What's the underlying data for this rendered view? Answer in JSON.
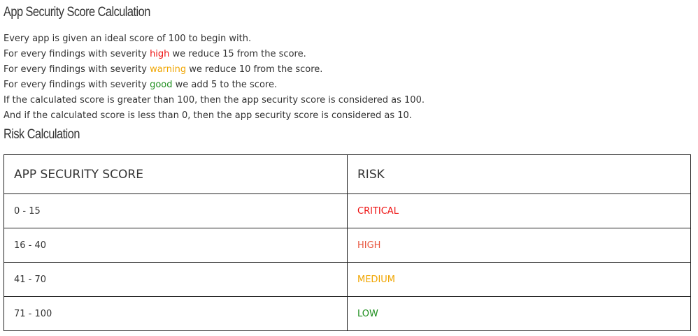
{
  "section1": {
    "title": "App Security Score Calculation",
    "intro": "Every app is given an ideal score of 100 to begin with.",
    "rules": [
      {
        "prefix": "For every findings with severity ",
        "severity": "high",
        "suffix": " we reduce 15 from the score."
      },
      {
        "prefix": "For every findings with severity ",
        "severity": "warning",
        "suffix": " we reduce 10 from the score."
      },
      {
        "prefix": "For every findings with severity ",
        "severity": "good",
        "suffix": " we add 5 to the score."
      }
    ],
    "note_max": "If the calculated score is greater than 100, then the app security score is considered as 100.",
    "note_min": "And if the calculated score is less than 0, then the app security score is considered as 10."
  },
  "section2": {
    "title": "Risk Calculation",
    "table": {
      "headers": [
        "APP SECURITY SCORE",
        "RISK"
      ],
      "rows": [
        {
          "score": "0 - 15",
          "risk": "CRITICAL"
        },
        {
          "score": "16 - 40",
          "risk": "HIGH"
        },
        {
          "score": "41 - 70",
          "risk": "MEDIUM"
        },
        {
          "score": "71 - 100",
          "risk": "LOW"
        }
      ]
    }
  },
  "colors": {
    "severity_high": "#ee1111",
    "severity_warning": "#f0a500",
    "severity_good": "#1f8f1f",
    "risk_critical": "#ee1111",
    "risk_high": "#e8573f",
    "risk_medium": "#f0a500",
    "risk_low": "#1f8f1f"
  }
}
